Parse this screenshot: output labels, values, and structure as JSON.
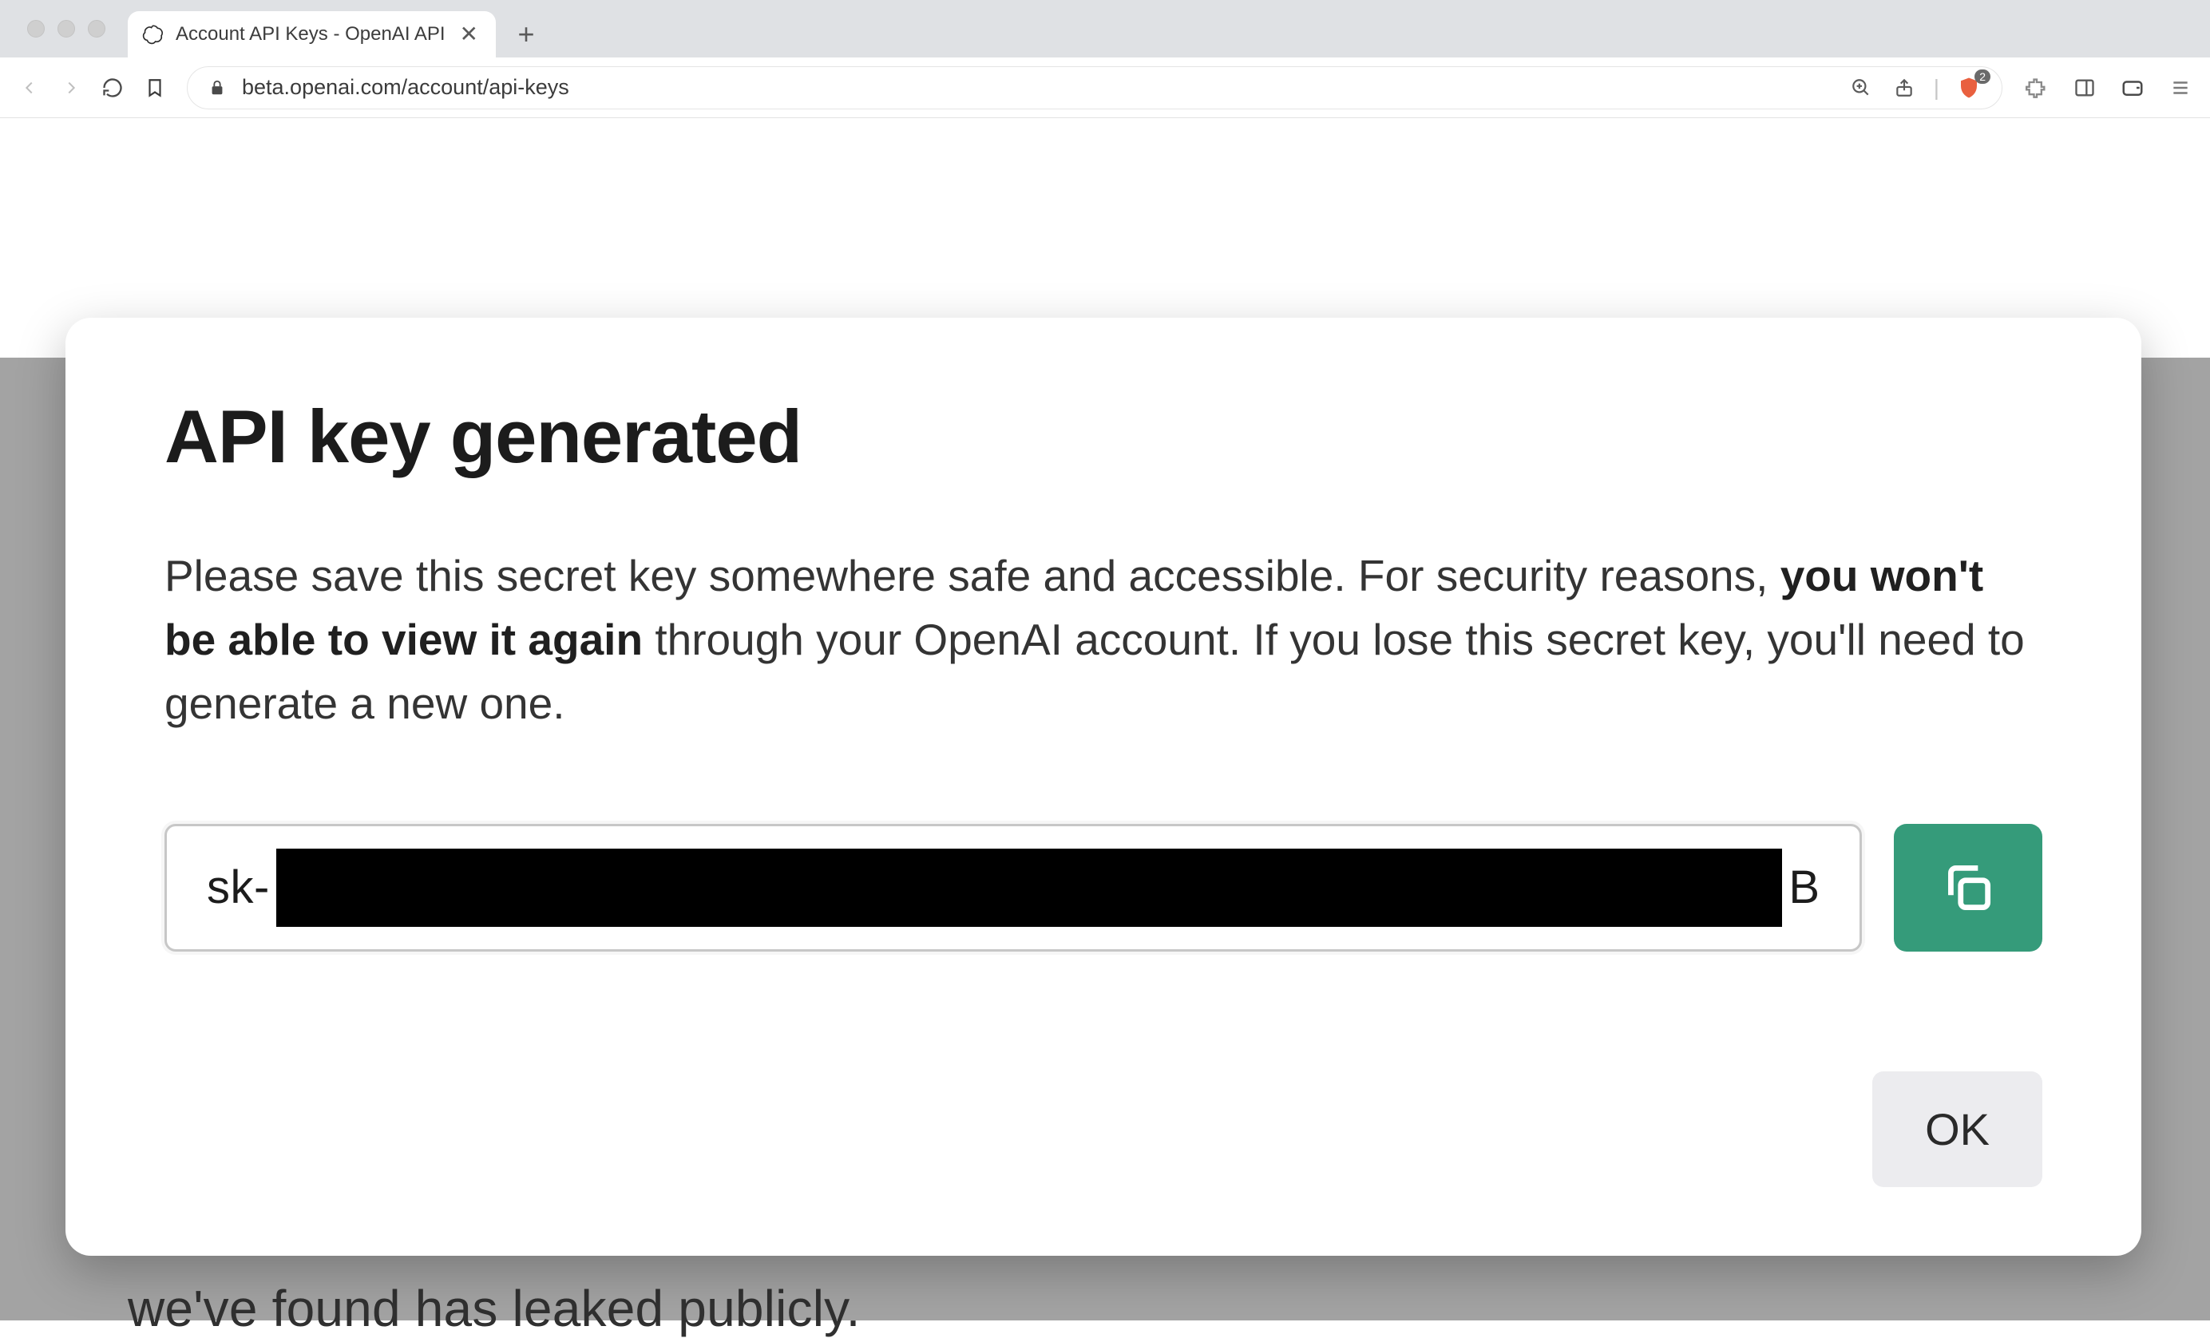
{
  "browser": {
    "tab_title": "Account API Keys - OpenAI API",
    "url_host": "beta.openai.com",
    "url_path": "/account/api-keys",
    "shield_badge": "2"
  },
  "page_bg_text": "we've found has leaked publicly.",
  "modal": {
    "title": "API key generated",
    "desc_before": "Please save this secret key somewhere safe and accessible. For security reasons, ",
    "desc_bold": "you won't be able to view it again",
    "desc_after": " through your OpenAI account. If you lose this secret key, you'll need to generate a new one.",
    "key_prefix": "sk-",
    "key_suffix": "B",
    "ok_label": "OK"
  }
}
